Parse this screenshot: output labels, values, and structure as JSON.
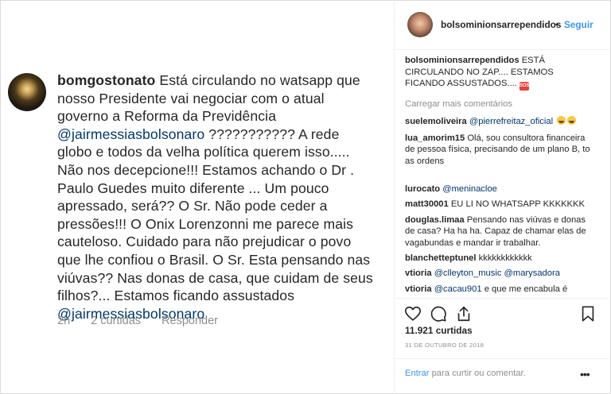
{
  "main_comment": {
    "username": "bomgostonato",
    "text_1": "Está circulando no watsapp que nosso Presidente vai negociar com o atual governo a Reforma da Previdência",
    "mention_1": "@jairmessiasbolsonaro",
    "text_2": "??????????? A rede globo e todos da velha política querem isso..... Não nos decepcione!!! Estamos achando o Dr . Paulo Guedes muito diferente ... Um pouco apressado, será?? O Sr. Não pode ceder a pressões!!! O Onix Lorenzonni me parece mais cauteloso. Cuidado para não prejudicar o povo que lhe confiou o Brasil. O Sr. Esta pensando nas viúvas?? Nas donas de casa, que cuidam de seus filhos?... Estamos ficando assustados",
    "mention_2": "@jairmessiasbolsonaro",
    "time": "2h",
    "likes": "2 curtidas",
    "reply": "Responder"
  },
  "post": {
    "username": "bolsominionsarrependidos",
    "dot": "•",
    "follow": "Seguir",
    "caption_user": "bolsominionsarrependidos",
    "caption_text": "ESTÁ CIRCULANDO NO ZAP.... ESTAMOS FICANDO ASSUSTADOS....",
    "sos": "SOS",
    "load_more": "Carregar mais comentários",
    "comments": [
      {
        "user": "suelemoliveira",
        "mention": "@pierrefreitaz_oficial",
        "text": "",
        "emoji": "laughing-crying-emoji"
      },
      {
        "user": "lua_amorim15",
        "mention": "",
        "text": "Olá, sou consultora financeira de pessoa física, precisando de um plano B, to as ordens"
      },
      {
        "user": "lurocato",
        "mention": "@meninacloe",
        "text": ""
      },
      {
        "user": "matt30001",
        "mention": "",
        "text": "EU LI NO WHATSAPP KKKKKKK"
      },
      {
        "user": "douglas.limaa",
        "mention": "",
        "text": "Pensando nas viúvas e donas de casa? Ha ha ha. Capaz de chamar elas de vagabundas e mandar ir trabalhar."
      },
      {
        "user": "blanchetteptunel",
        "mention": "",
        "text": "kkkkkkkkkkkk"
      },
      {
        "user": "vtioria",
        "mention": "@clleyton_music @marysadora",
        "text": ""
      },
      {
        "user": "vtioria",
        "mention": "@cacau901",
        "text": "e que me encabula é"
      }
    ],
    "likes_count": "11.921 curtidas",
    "date": "31 DE OUTUBRO DE 2018",
    "input_link": "Entrar",
    "input_rest": " para curtir ou comentar.",
    "more_dots": "•••"
  },
  "colors": {
    "link": "#3897f0",
    "mention": "#00376b",
    "muted": "#8e8e8e",
    "text": "#262626"
  }
}
